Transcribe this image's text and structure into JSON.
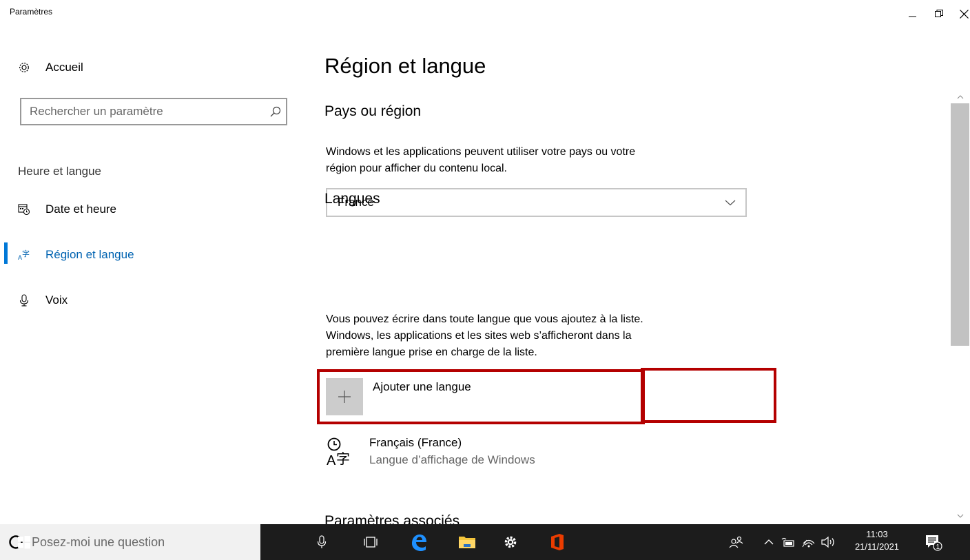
{
  "window": {
    "title": "Paramètres",
    "controls": {
      "minimize": "–",
      "restore": "❐",
      "close": "✕"
    }
  },
  "sidebar": {
    "home_label": "Accueil",
    "search_placeholder": "Rechercher un paramètre",
    "section_title": "Heure et langue",
    "items": [
      {
        "label": "Date et heure",
        "icon": "calendar-clock-icon",
        "active": false
      },
      {
        "label": "Région et langue",
        "icon": "region-language-icon",
        "active": true
      },
      {
        "label": "Voix",
        "icon": "microphone-icon",
        "active": false
      }
    ]
  },
  "main": {
    "title": "Région et langue",
    "country": {
      "heading": "Pays ou région",
      "description_line1": "Windows et les applications peuvent utiliser votre pays ou votre",
      "description_line2": "région pour afficher du contenu local.",
      "selected": "France"
    },
    "languages": {
      "heading": "Langues",
      "description_line1": "Vous pouvez écrire dans toute langue que vous ajoutez à la liste.",
      "description_line2": "Windows, les applications et les sites web s’afficheront dans la",
      "description_line3": "première langue prise en charge de la liste.",
      "add_label": "Ajouter une langue",
      "list": [
        {
          "name": "Français (France)",
          "sub": "Langue d’affichage de Windows"
        }
      ]
    },
    "related_heading": "Paramètres associés"
  },
  "taskbar": {
    "search_placeholder": "Posez-moi une question",
    "time": "11:03",
    "date": "21/11/2021",
    "notification_count": "1"
  },
  "colors": {
    "accent": "#0078d7",
    "accent_text": "#0063b1",
    "highlight_red": "#b40000",
    "taskbar_bg": "#1c1c1c",
    "office_orange": "#eb3c00",
    "edge_blue": "#1e90ff",
    "folder_yellow": "#f4c53c"
  }
}
